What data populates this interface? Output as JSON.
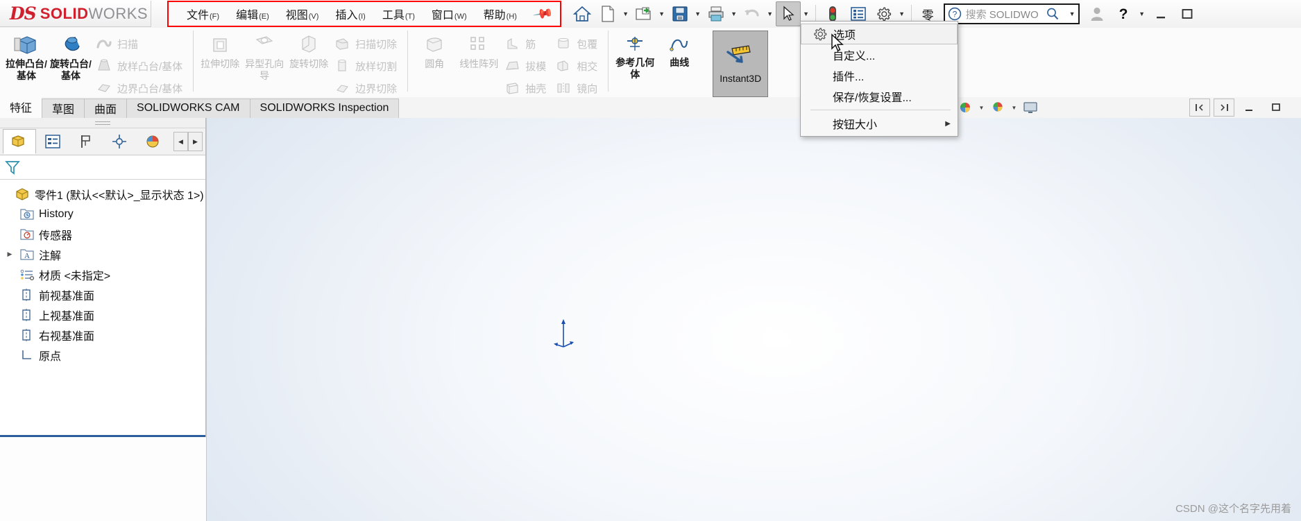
{
  "app": {
    "brand_ds": "DS",
    "brand_solid": "SOLID",
    "brand_works": "WORKS",
    "accent_red": "#d0202e",
    "highlight_red": "#ff0000"
  },
  "menubar": {
    "items": [
      {
        "label": "文件",
        "key": "(F)",
        "name": "menu-file"
      },
      {
        "label": "编辑",
        "key": "(E)",
        "name": "menu-edit"
      },
      {
        "label": "视图",
        "key": "(V)",
        "name": "menu-view"
      },
      {
        "label": "插入",
        "key": "(I)",
        "name": "menu-insert"
      },
      {
        "label": "工具",
        "key": "(T)",
        "name": "menu-tools"
      },
      {
        "label": "窗口",
        "key": "(W)",
        "name": "menu-window"
      },
      {
        "label": "帮助",
        "key": "(H)",
        "name": "menu-help"
      }
    ],
    "pin_icon": "pushpin-icon"
  },
  "quick_toolbar": {
    "buttons": [
      {
        "name": "home-button",
        "icon": "home-icon"
      },
      {
        "name": "new-document-button",
        "icon": "new-file-icon"
      },
      {
        "name": "open-button",
        "icon": "open-folder-icon"
      },
      {
        "name": "save-button",
        "icon": "save-floppy-icon"
      },
      {
        "name": "print-button",
        "icon": "printer-icon"
      },
      {
        "name": "undo-button",
        "icon": "undo-arrow-icon"
      },
      {
        "name": "select-button",
        "icon": "cursor-arrow-icon"
      },
      {
        "name": "rebuild-button",
        "icon": "traffic-light-icon"
      },
      {
        "name": "file-properties-button",
        "icon": "properties-list-icon"
      },
      {
        "name": "options-button",
        "icon": "gear-icon"
      }
    ],
    "zero_label": "零"
  },
  "search": {
    "icon": "help-question-icon",
    "label_cn": "搜索",
    "label_en": "SOLIDWO",
    "magnifier_icon": "magnifier-icon"
  },
  "window_controls": {
    "account_icon": "user-account-icon",
    "help_icon": "question-mark-icon",
    "minimize_icon": "minimize-icon",
    "maximize_icon": "maximize-icon"
  },
  "ribbon": {
    "group1": [
      {
        "label": "拉伸凸台/基体",
        "name": "extruded-boss-base-button",
        "dim": false,
        "icon": "extrude-boss-icon"
      },
      {
        "label": "旋转凸台/基体",
        "name": "revolved-boss-base-button",
        "dim": false,
        "icon": "revolve-boss-icon"
      }
    ],
    "group1_small": [
      {
        "label": "扫描",
        "name": "swept-boss-button",
        "icon": "sweep-icon"
      },
      {
        "label": "放样凸台/基体",
        "name": "lofted-boss-button",
        "icon": "loft-icon"
      },
      {
        "label": "边界凸台/基体",
        "name": "boundary-boss-button",
        "icon": "boundary-icon"
      }
    ],
    "group2": [
      {
        "label": "拉伸切除",
        "name": "extruded-cut-button",
        "icon": "extrude-cut-icon"
      },
      {
        "label": "异型孔向导",
        "name": "hole-wizard-button",
        "icon": "hole-wizard-icon"
      },
      {
        "label": "旋转切除",
        "name": "revolved-cut-button",
        "icon": "revolve-cut-icon"
      }
    ],
    "group2_small": [
      {
        "label": "扫描切除",
        "name": "swept-cut-button",
        "icon": "sweep-cut-icon"
      },
      {
        "label": "放样切割",
        "name": "lofted-cut-button",
        "icon": "loft-cut-icon"
      },
      {
        "label": "边界切除",
        "name": "boundary-cut-button",
        "icon": "boundary-cut-icon"
      }
    ],
    "group3": [
      {
        "label": "圆角",
        "name": "fillet-button",
        "icon": "fillet-icon"
      },
      {
        "label": "线性阵列",
        "name": "linear-pattern-button",
        "icon": "linear-pattern-icon"
      }
    ],
    "group3_small": [
      {
        "label": "筋",
        "name": "rib-button",
        "icon": "rib-icon"
      },
      {
        "label": "拔模",
        "name": "draft-button",
        "icon": "draft-icon"
      },
      {
        "label": "抽壳",
        "name": "shell-button",
        "icon": "shell-icon"
      }
    ],
    "group4_small": [
      {
        "label": "包覆",
        "name": "wrap-button",
        "icon": "wrap-icon"
      },
      {
        "label": "相交",
        "name": "intersect-button",
        "icon": "intersect-icon"
      },
      {
        "label": "镜向",
        "name": "mirror-button",
        "icon": "mirror-icon"
      }
    ],
    "group5": [
      {
        "label": "参考几何体",
        "name": "reference-geometry-button",
        "icon": "reference-geometry-icon"
      },
      {
        "label": "曲线",
        "name": "curves-button",
        "icon": "curves-icon"
      }
    ],
    "instant3d": {
      "label": "Instant3D",
      "name": "instant3d-button",
      "icon": "ruler-arrow-icon"
    }
  },
  "tabs": {
    "active": "特征",
    "items": [
      "草图",
      "曲面",
      "SOLIDWORKS CAM",
      "SOLIDWORKS Inspection"
    ]
  },
  "view_toolbar": {
    "buttons": [
      {
        "name": "zoom-to-fit-button",
        "icon": "zoom-fit-icon"
      },
      {
        "name": "zoom-to-area-button",
        "icon": "zoom-area-icon"
      },
      {
        "name": "section-view-button",
        "icon": "section-view-icon"
      },
      {
        "name": "view-orientation-button",
        "icon": "view-orientation-icon"
      },
      {
        "name": "display-style-button",
        "icon": "display-style-icon"
      },
      {
        "name": "hide-show-items-button",
        "icon": "hide-show-icon"
      },
      {
        "name": "edit-appearance-button",
        "icon": "appearance-sphere-icon"
      },
      {
        "name": "apply-scene-button",
        "icon": "scene-sphere-icon"
      },
      {
        "name": "view-settings-button",
        "icon": "monitor-icon"
      }
    ]
  },
  "panel_buttons": {
    "collapse_left": "collapse-left-icon",
    "expand_right": "expand-right-icon",
    "minimize": "minimize-icon",
    "restore": "restore-icon"
  },
  "feature_manager": {
    "tabs": [
      {
        "name": "feature-manager-tab",
        "icon": "feature-tree-icon"
      },
      {
        "name": "property-manager-tab",
        "icon": "property-list-icon"
      },
      {
        "name": "configuration-manager-tab",
        "icon": "configuration-flag-icon"
      },
      {
        "name": "dimxpert-manager-tab",
        "icon": "dimxpert-icon"
      },
      {
        "name": "display-manager-tab",
        "icon": "display-pie-icon"
      }
    ],
    "filter_icon": "filter-funnel-icon",
    "tree": [
      {
        "label": "零件1  (默认<<默认>_显示状态 1>)",
        "name": "tree-root-part",
        "icon": "part-icon",
        "indent": 0,
        "expandable": false
      },
      {
        "label": "History",
        "name": "tree-item-history",
        "icon": "history-folder-icon",
        "indent": 1,
        "expandable": false
      },
      {
        "label": "传感器",
        "name": "tree-item-sensors",
        "icon": "sensors-folder-icon",
        "indent": 1,
        "expandable": false
      },
      {
        "label": "注解",
        "name": "tree-item-annotations",
        "icon": "annotations-folder-icon",
        "indent": 1,
        "expandable": true
      },
      {
        "label": "材质 <未指定>",
        "name": "tree-item-material",
        "icon": "material-icon",
        "indent": 1,
        "expandable": false
      },
      {
        "label": "前视基准面",
        "name": "tree-item-front-plane",
        "icon": "plane-icon",
        "indent": 1,
        "expandable": false
      },
      {
        "label": "上视基准面",
        "name": "tree-item-top-plane",
        "icon": "plane-icon",
        "indent": 1,
        "expandable": false
      },
      {
        "label": "右视基准面",
        "name": "tree-item-right-plane",
        "icon": "plane-icon",
        "indent": 1,
        "expandable": false
      },
      {
        "label": "原点",
        "name": "tree-item-origin",
        "icon": "origin-icon",
        "indent": 1,
        "expandable": false
      }
    ]
  },
  "dropdown_menu": {
    "items": [
      {
        "label": "选项",
        "name": "menu-item-options",
        "icon": "gear-icon",
        "highlighted": true,
        "submenu": false
      },
      {
        "label": "自定义...",
        "name": "menu-item-customize",
        "icon": "",
        "highlighted": false,
        "submenu": false
      },
      {
        "label": "插件...",
        "name": "menu-item-addins",
        "icon": "",
        "highlighted": false,
        "submenu": false
      },
      {
        "label": "保存/恢复设置...",
        "name": "menu-item-save-restore-settings",
        "icon": "",
        "highlighted": false,
        "submenu": false
      },
      {
        "label": "按钮大小",
        "name": "menu-item-button-size",
        "icon": "",
        "highlighted": false,
        "submenu": true
      }
    ]
  },
  "graphics": {
    "watermark": "CSDN @这个名字先用着",
    "origin_label": ""
  }
}
